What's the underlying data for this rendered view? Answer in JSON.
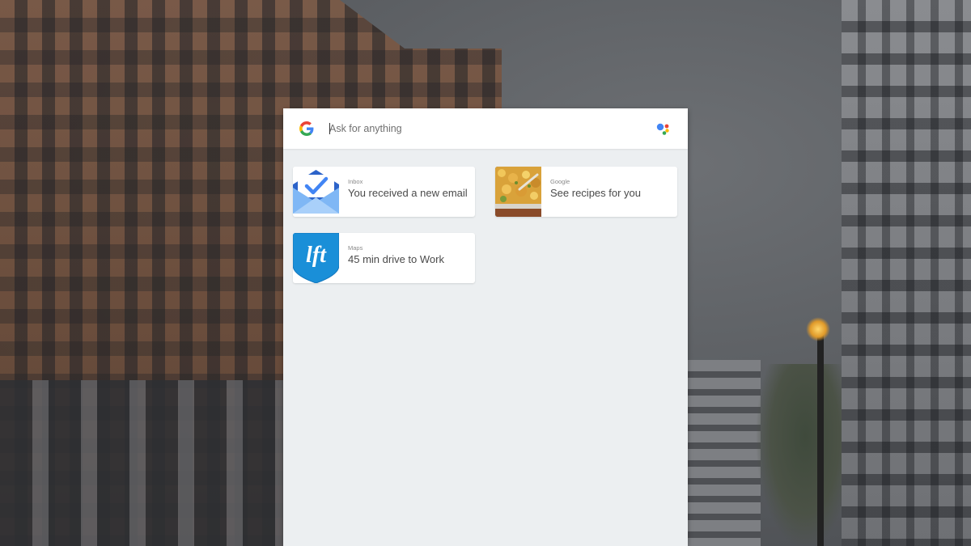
{
  "search": {
    "placeholder": "Ask for anything"
  },
  "cards": [
    {
      "source": "Inbox",
      "title": "You received a new email",
      "icon": "inbox-icon"
    },
    {
      "source": "Google",
      "title": "See recipes for you",
      "icon": "recipe-photo"
    },
    {
      "source": "Maps",
      "title": "45 min drive to Work",
      "icon": "lyft-icon"
    }
  ],
  "icons": {
    "google_logo": "google-logo-icon",
    "assistant": "assistant-icon"
  },
  "colors": {
    "google_blue": "#4285F4",
    "google_red": "#EA4335",
    "google_yellow": "#FBBC05",
    "google_green": "#34A853",
    "inbox_blue": "#4285F4",
    "maps_blue": "#1A73E8",
    "panel_bg": "#ECEFF1"
  }
}
